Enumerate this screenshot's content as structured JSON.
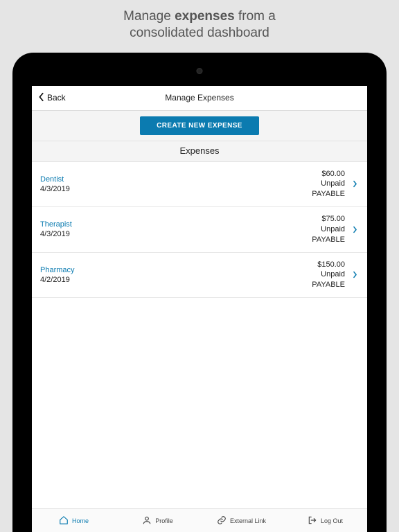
{
  "marketing": {
    "line1_pre": "Manage ",
    "line1_strong": "expenses",
    "line1_post": " from a",
    "line2": "consolidated dashboard"
  },
  "navbar": {
    "back_label": "Back",
    "title": "Manage Expenses"
  },
  "create_button_label": "CREATE NEW EXPENSE",
  "section_title": "Expenses",
  "colors": {
    "accent": "#0b7bb0"
  },
  "expenses": [
    {
      "title": "Dentist",
      "date": "4/3/2019",
      "amount": "$60.00",
      "status": "Unpaid",
      "substatus": "PAYABLE"
    },
    {
      "title": "Therapist",
      "date": "4/3/2019",
      "amount": "$75.00",
      "status": "Unpaid",
      "substatus": "PAYABLE"
    },
    {
      "title": "Pharmacy",
      "date": "4/2/2019",
      "amount": "$150.00",
      "status": "Unpaid",
      "substatus": "PAYABLE"
    }
  ],
  "tabs": {
    "home": "Home",
    "profile": "Profile",
    "external": "External Link",
    "logout": "Log Out"
  }
}
